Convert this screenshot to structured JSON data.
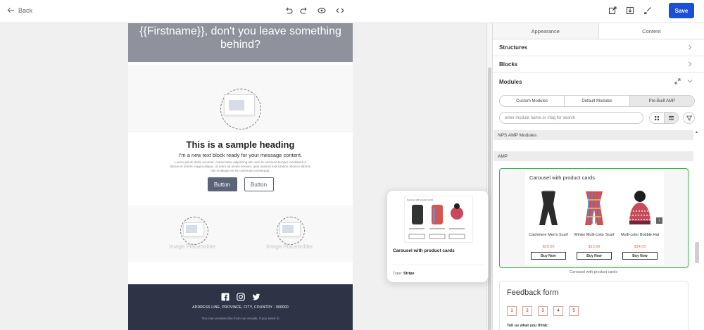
{
  "topbar": {
    "back_label": "Back",
    "save_label": "Save",
    "icons": [
      "undo-icon",
      "redo-icon",
      "eye-icon",
      "code-icon",
      "export-icon",
      "download-icon",
      "brush-icon"
    ]
  },
  "email": {
    "hero_text": "{{Firstname}}, don't you leave something behind?",
    "heading": "This is a sample heading",
    "subtext": "I'm a new text block ready for your message content.",
    "lorem": "Lorem ipsum dolor sit amet, consectetur adipiscing elit, sed do eiusmod tempor incididunt ut labore et dolore magna aliqua. Ut enim ad minim veniam, quis nostrud exercitation ullamco laboris nisi ut aliquip ex ea commodo consequat.",
    "button_primary": "Button",
    "button_secondary": "Button",
    "image_placeholder_left": "Image Placeholder",
    "image_placeholder_right": "Image Placeholder",
    "footer_address": "ADDRESS LINE, PROVINCE, CITY, COUNTRY - 000000",
    "footer_unsub": "You can unsubscribe from our emails, if you need to"
  },
  "preview": {
    "title": "Carousel with product cards",
    "type_label": "Type:",
    "type_value": "Stripe",
    "mini_title": "Carousel with product cards"
  },
  "panel": {
    "tabs": [
      "Appearance",
      "Content"
    ],
    "sections": [
      "Structures",
      "Blocks",
      "Modules"
    ],
    "segments": [
      "Custom Modules",
      "Default Modules",
      "Pre-Built AMP"
    ],
    "search_placeholder": "enter module name or #tag for search",
    "group1": "NPS AMP Modules",
    "group2": "AMP",
    "carousel_title": "Carousel with product cards",
    "products": [
      {
        "name": "Cashmere Men's Scarf",
        "price": "$25.00",
        "buy": "Buy Now"
      },
      {
        "name": "Winter Multi-color Scarf",
        "price": "$15.99",
        "buy": "Buy Now"
      },
      {
        "name": "Multi-color Bobble Hat",
        "price": "$34.00",
        "buy": "Buy Now"
      }
    ],
    "card_caption": "Carousel with product cards",
    "feedback_title": "Feedback form",
    "feedback_scale": [
      "1",
      "2",
      "3",
      "4",
      "5"
    ],
    "feedback_question": "Tell us what you think:"
  }
}
